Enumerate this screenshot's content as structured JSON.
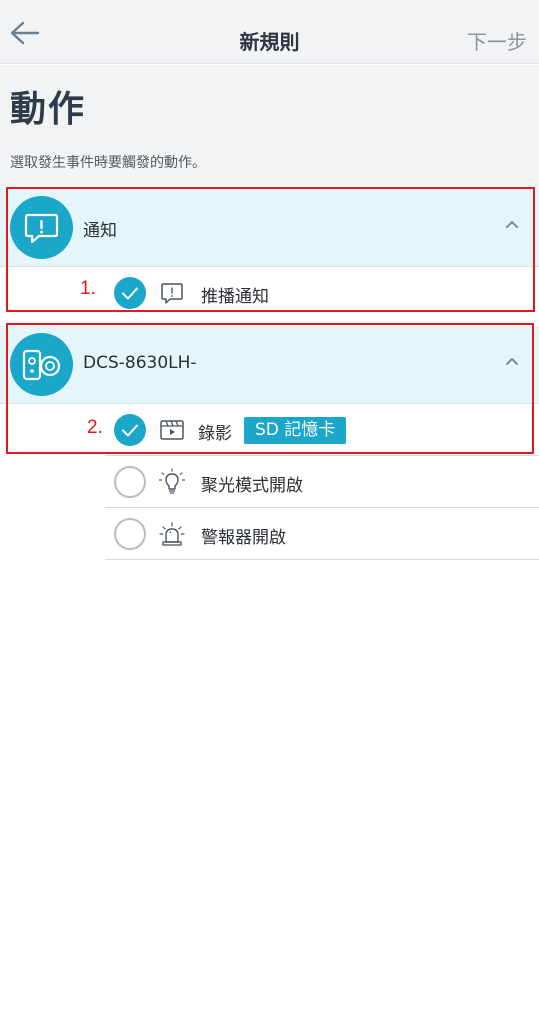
{
  "header": {
    "title": "新規則",
    "next_label": "下一步"
  },
  "page": {
    "heading": "動作",
    "subtitle": "選取發生事件時要觸發的動作。"
  },
  "groups": [
    {
      "title": "通知",
      "icon": "notification-bubble-icon",
      "expanded": true,
      "items": [
        {
          "label": "推播通知",
          "icon": "alert-bubble-icon",
          "checked": true
        }
      ]
    },
    {
      "title": "DCS-8630LH-",
      "icon": "camera-device-icon",
      "expanded": true,
      "items": [
        {
          "label": "錄影",
          "badge": "SD 記憶卡",
          "icon": "video-clapper-icon",
          "checked": true
        },
        {
          "label": "聚光模式開啟",
          "icon": "light-bulb-icon",
          "checked": false
        },
        {
          "label": "警報器開啟",
          "icon": "siren-icon",
          "checked": false
        }
      ]
    }
  ],
  "annotations": {
    "first": "1.",
    "second": "2."
  },
  "colors": {
    "accent": "#1aa7c9",
    "annotation": "#e3181f",
    "group_bg": "#e5f6fb",
    "header_bg": "#f2f3f5"
  }
}
